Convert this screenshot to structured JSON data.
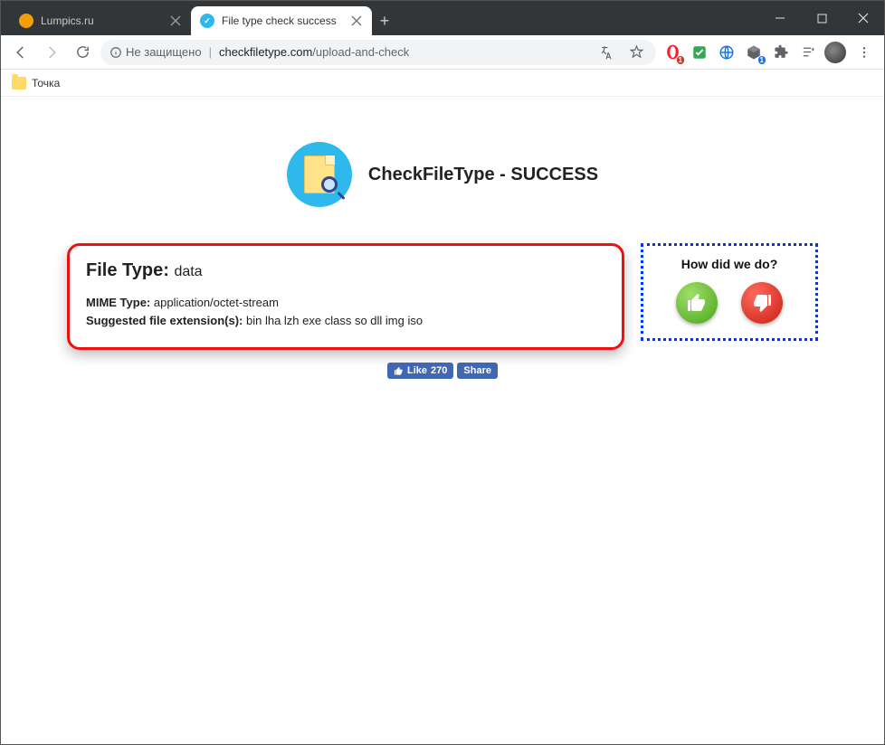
{
  "window": {
    "tabs": [
      {
        "title": "Lumpics.ru",
        "active": false,
        "icon_color": "#f59e0b"
      },
      {
        "title": "File type check success",
        "active": true,
        "icon_color": "#2fb8ec"
      }
    ]
  },
  "toolbar": {
    "secure_label": "Не защищено",
    "url_host": "checkfiletype.com",
    "url_path": "/upload-and-check"
  },
  "bookmarks": {
    "item1": "Точка"
  },
  "page": {
    "title": "CheckFileType - SUCCESS",
    "result": {
      "file_type_label": "File Type:",
      "file_type_value": "data",
      "mime_label": "MIME Type:",
      "mime_value": "application/octet-stream",
      "ext_label": "Suggested file extension(s):",
      "ext_value": "bin lha lzh exe class so dll img iso"
    },
    "feedback": {
      "title": "How did we do?"
    },
    "fb": {
      "like_label": "Like",
      "like_count": "270",
      "share_label": "Share"
    }
  }
}
